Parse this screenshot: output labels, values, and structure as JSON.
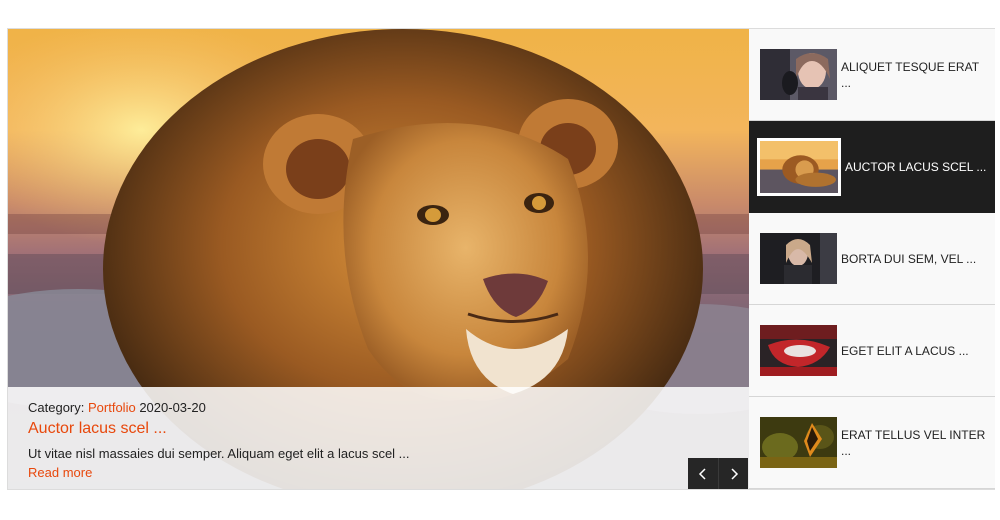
{
  "hero": {
    "image": "lion-photo",
    "category_prefix": "Category:",
    "category_link": "Portfolio",
    "date": "2020-03-20",
    "title": "Auctor lacus scel ...",
    "excerpt": "Ut vitae nisl massaies dui semper. Aliquam eget elit a lacus scel ...",
    "read_more": "Read more"
  },
  "nav": {
    "prev_icon": "chevron-left-icon",
    "next_icon": "chevron-right-icon"
  },
  "thumbs": [
    {
      "label": "ALIQUET TESQUE ERAT ...",
      "image": "woman-portrait",
      "active": false
    },
    {
      "label": "AUCTOR LACUS SCEL ...",
      "image": "lion-photo",
      "active": true
    },
    {
      "label": "BORTA DUI SEM, VEL ...",
      "image": "woman-dark-portrait",
      "active": false
    },
    {
      "label": "EGET ELIT A LACUS ...",
      "image": "red-interior",
      "active": false
    },
    {
      "label": "ERAT TELLUS VEL INTER ...",
      "image": "butterfly",
      "active": false
    }
  ],
  "colors": {
    "accent": "#e8480c",
    "active_bg": "#1e1e1e",
    "nav_bg": "#262626"
  }
}
